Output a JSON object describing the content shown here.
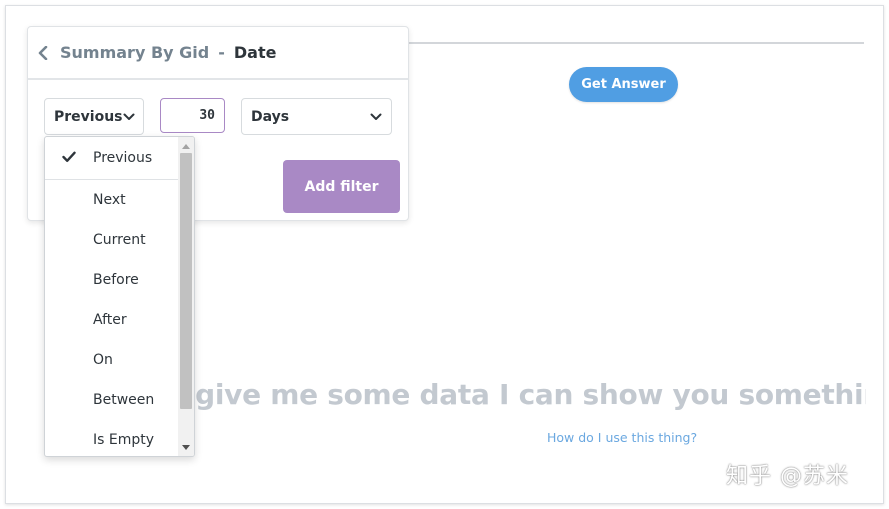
{
  "header": {
    "back_icon": "chevron-left-icon",
    "parent": "Summary By Gid",
    "separator": "-",
    "current": "Date"
  },
  "filter": {
    "operator": "Previous",
    "amount": "30",
    "unit": "Days",
    "add_label": "Add filter",
    "accent_color": "#a989c5"
  },
  "dropdown": {
    "selected": "Previous",
    "items": [
      "Previous",
      "Next",
      "Current",
      "Before",
      "After",
      "On",
      "Between",
      "Is Empty"
    ]
  },
  "main": {
    "get_answer_label": "Get Answer",
    "get_answer_color": "#509ee3",
    "empty_message": "u give me some data I can show you something",
    "help_link": "How do I use this thing?"
  },
  "watermark": "知乎 @苏米"
}
